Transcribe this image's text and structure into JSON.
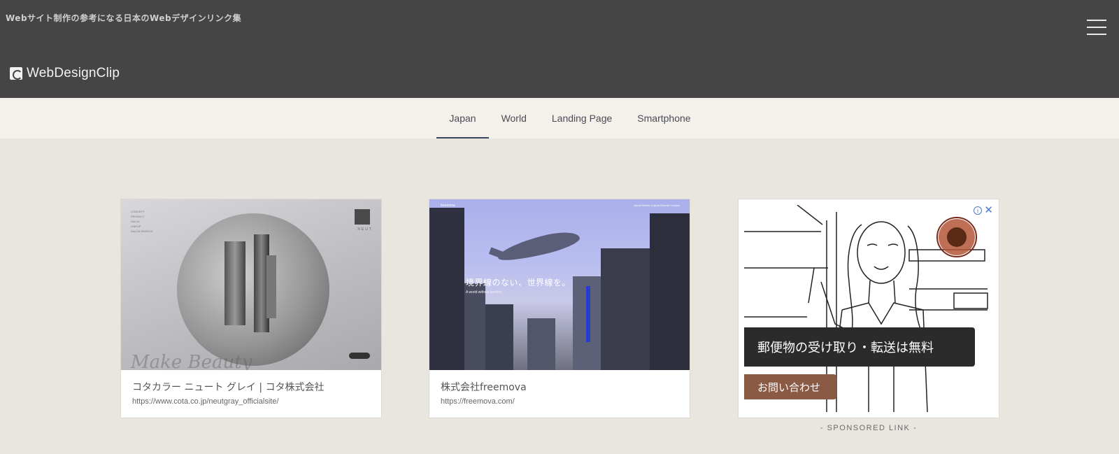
{
  "header": {
    "tagline": "Webサイト制作の参考になる日本のWebデザインリンク集",
    "logo_text": "WebDesignClip",
    "menu_icon": "hamburger-icon"
  },
  "nav": {
    "tabs": [
      {
        "label": "Japan",
        "active": true
      },
      {
        "label": "World",
        "active": false
      },
      {
        "label": "Landing Page",
        "active": false
      },
      {
        "label": "Smartphone",
        "active": false
      }
    ]
  },
  "cards": [
    {
      "title": "コタカラー ニュート グレイ | コタ株式会社",
      "url": "https://www.cota.co.jp/neutgray_officialsite/",
      "thumb": {
        "menu": [
          "CONCEPT",
          "PRODUCT",
          "VALUE",
          "LINEUP",
          "SALON SEARCH"
        ],
        "brand": "NEUT",
        "script": "Make Beauty"
      }
    },
    {
      "title": "株式会社freemova",
      "url": "https://freemova.com/",
      "thumb": {
        "logo": "freemova",
        "nav": "About  Works  Culture  Recruit  Contact",
        "headline": "境界線のない、世界線を。",
        "subline": "A world without borders"
      }
    }
  ],
  "ad": {
    "banner_text": "郵便物の受け取り・転送は無料",
    "cta_label": "お問い合わせ",
    "info_icon": "i",
    "close_icon": "✕",
    "sponsored_label": "- SPONSORED LINK -"
  },
  "colors": {
    "header_bg": "#454545",
    "nav_bg": "#f4f1eb",
    "page_bg": "#e9e5df",
    "active_underline": "#3a4660",
    "ad_cta": "#8a5a45"
  }
}
